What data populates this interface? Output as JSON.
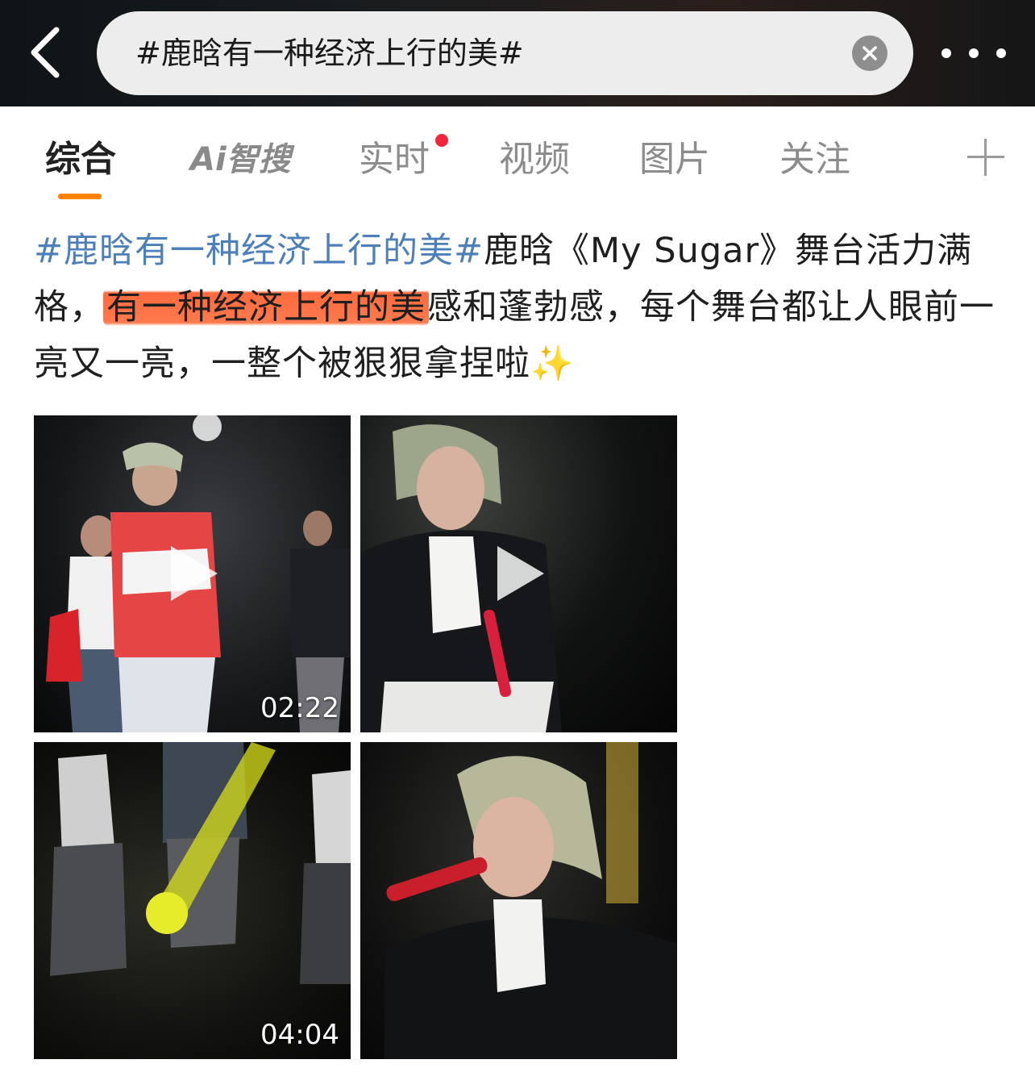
{
  "header": {
    "search_query": "#鹿晗有一种经济上行的美#",
    "back_icon": "chevron-left-icon",
    "clear_icon": "close-icon",
    "more_icon": "more-dots-icon"
  },
  "tabs": [
    {
      "label": "综合",
      "active": true
    },
    {
      "label": "Ai智搜",
      "active": false
    },
    {
      "label": "实时",
      "active": false,
      "badge": "red-dot"
    },
    {
      "label": "视频",
      "active": false
    },
    {
      "label": "图片",
      "active": false
    },
    {
      "label": "关注",
      "active": false
    }
  ],
  "post": {
    "hashtag": "#鹿晗有一种经济上行的美#",
    "text_1": "鹿晗《My Sugar》舞台活力满格，",
    "highlight": "有一种经济上行的美",
    "text_2": "感和蓬勃感，每个舞台都让人眼前一亮又一亮，一整个被狠狠拿捏啦",
    "emoji": "✨"
  },
  "media": [
    {
      "type": "video",
      "duration": "02:22"
    },
    {
      "type": "video",
      "duration": ""
    },
    {
      "type": "video",
      "duration": "04:04"
    },
    {
      "type": "image",
      "duration": ""
    }
  ],
  "colors": {
    "hashtag": "#4d7fb8",
    "highlight": "#ff6a3d",
    "active_tab_underline": "#ff8200",
    "live_dot": "#f0263a"
  }
}
